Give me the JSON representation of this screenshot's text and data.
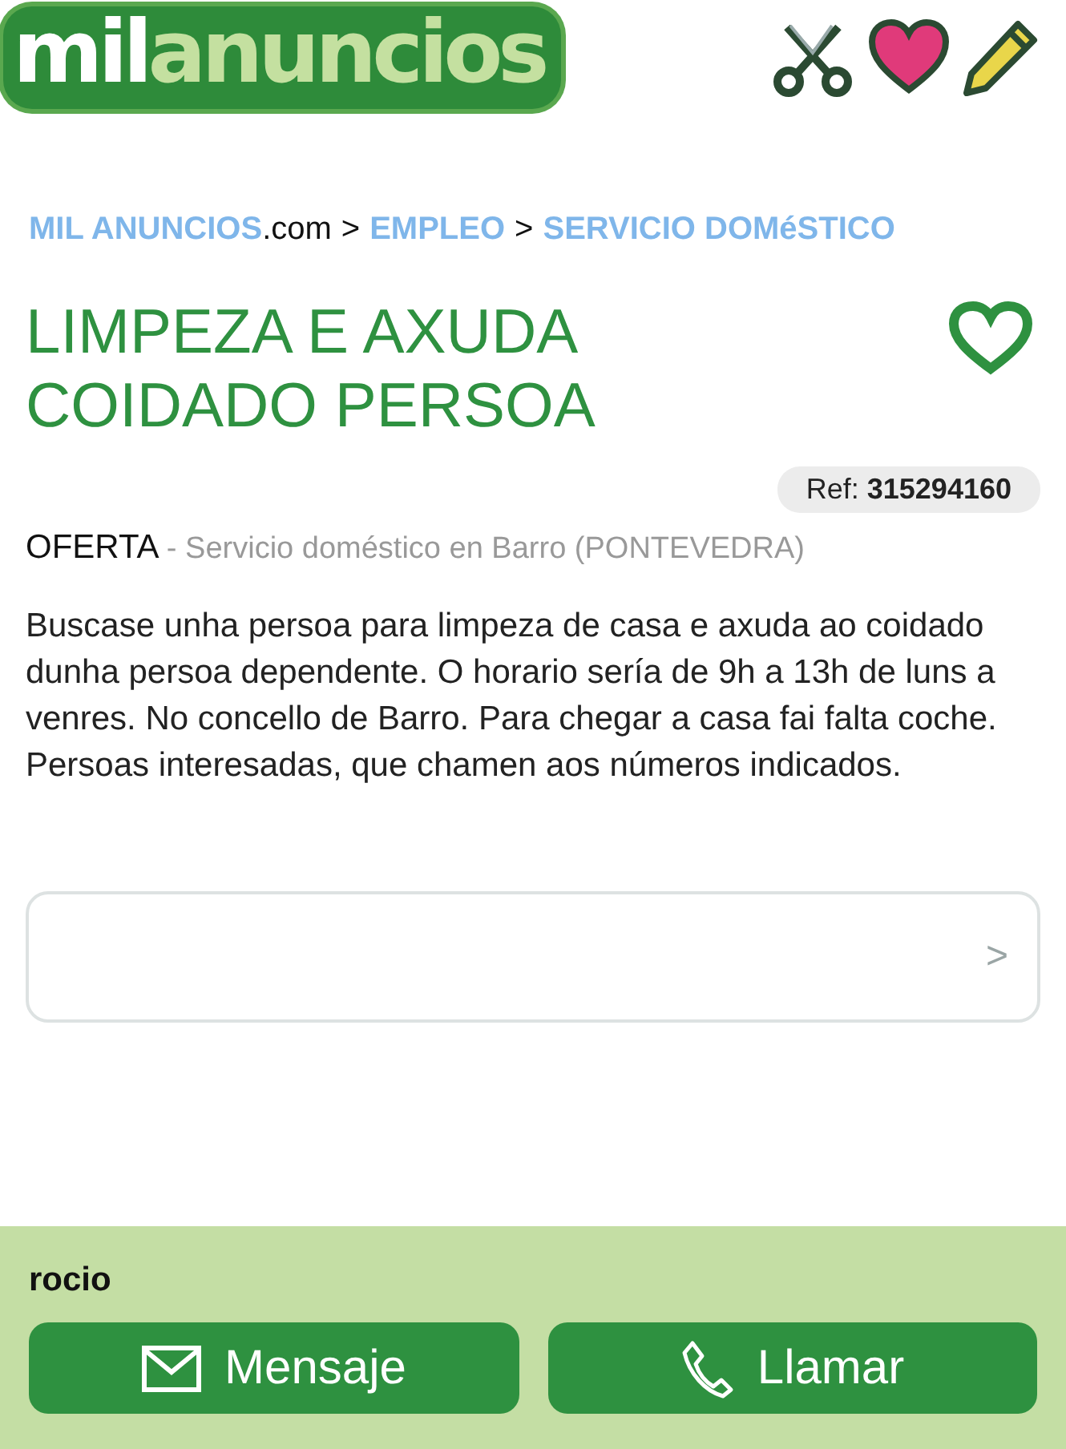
{
  "logo": {
    "part_1": "mil",
    "part_2": "anuncios"
  },
  "breadcrumb": [
    {
      "label": "MIL ANUNCIOS",
      "suffix": ".com"
    },
    {
      "label": "EMPLEO"
    },
    {
      "label": "SERVICIO DOMéSTICO"
    }
  ],
  "breadcrumb_separator": ">",
  "ad": {
    "title": "LIMPEZA E AXUDA COIDADO PERSOA",
    "favorite": false,
    "ref_label": "Ref:",
    "ref": "315294160",
    "type": "OFERTA",
    "category": "- Servicio doméstico en Barro (PONTEVEDRA)",
    "description": "Buscase unha persoa para limpeza de casa e axuda ao coidado dunha persoa dependente. O horario sería de 9h a 13h de luns a venres. No concello de Barro. Para chegar a casa fai falta coche. Persoas interesadas, que chamen aos números indicados.",
    "link_chevron": ">"
  },
  "contact": {
    "name": "rocio",
    "buttons": [
      {
        "kind": "message",
        "label": "Mensaje"
      },
      {
        "kind": "call",
        "label": "Llamar"
      }
    ]
  }
}
